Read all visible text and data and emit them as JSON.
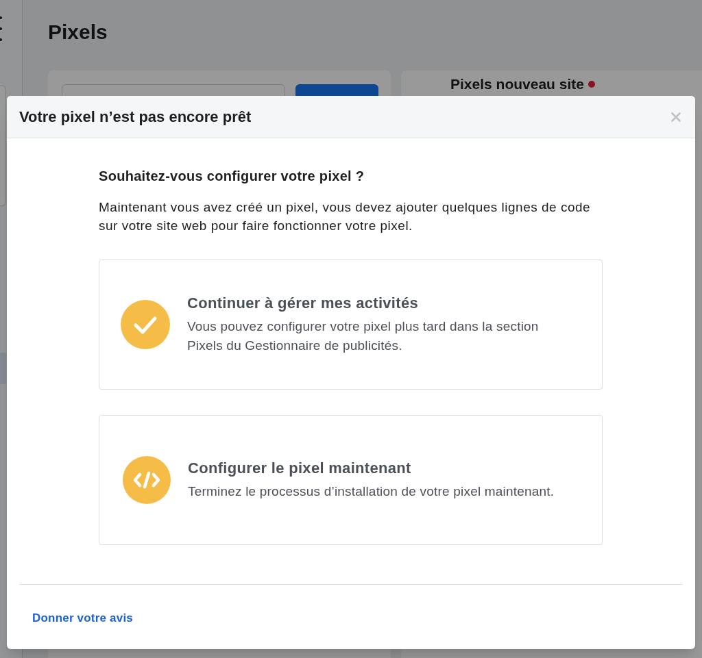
{
  "page": {
    "title": "Pixels",
    "pixel_panel": {
      "title": "Pixels nouveau site"
    }
  },
  "dialog": {
    "title": "Votre pixel n’est pas encore prêt",
    "heading": "Souhaitez-vous configurer votre pixel ?",
    "intro": "Maintenant vous avez créé un pixel, vous devez ajouter quelques lignes de code sur votre site web pour faire fonctionner votre pixel.",
    "options": [
      {
        "kind": "check",
        "title": "Continuer à gérer mes activités",
        "description": "Vous pouvez configurer votre pixel plus tard dans la section Pixels du Gestionnaire de publicités."
      },
      {
        "kind": "code",
        "title": "Configurer le pixel maintenant",
        "description": "Terminez le processus d’installation de votre pixel maintenant."
      }
    ],
    "feedback_link": "Donner votre avis"
  }
}
